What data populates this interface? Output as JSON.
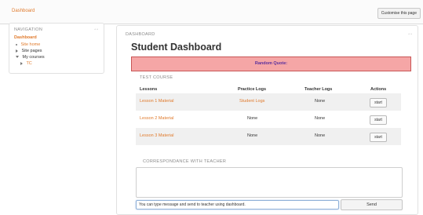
{
  "breadcrumb": {
    "home": "Dashboard"
  },
  "header": {
    "customise_label": "Customise this page"
  },
  "navigation": {
    "title": "NAVIGATION",
    "block_icons": "▫▫",
    "items": [
      {
        "label": "Dashboard",
        "level": 0
      },
      {
        "label": "Site home",
        "level": 1
      },
      {
        "label": "Site pages",
        "level": 1
      },
      {
        "label": "My courses",
        "level": 1
      },
      {
        "label": "TC",
        "level": 2
      }
    ]
  },
  "dashboard": {
    "block_title": "DASHBOARD",
    "block_icons": "▫▫",
    "title": "Student Dashboard",
    "quote_label": "Random Quote:",
    "course_heading": "TEST COURSE",
    "columns": [
      "Lessons",
      "Practice Logs",
      "Teacher Logs",
      "Actions"
    ],
    "rows": [
      {
        "lesson": "Lesson 1 Material",
        "practice": "Student Logs",
        "teacher": "None",
        "action": "start"
      },
      {
        "lesson": "Lesson 2 Material",
        "practice": "None",
        "teacher": "None",
        "action": "start"
      },
      {
        "lesson": "Lesson 3 Material",
        "practice": "None",
        "teacher": "None",
        "action": "start"
      }
    ],
    "correspondence_heading": "CORRESPONDANCE WITH TEACHER",
    "message_value": "You can type message and send to teacher using dashboard.",
    "send_label": "Send"
  },
  "colors": {
    "link": "#e07a2c",
    "quote_bg": "#f5a6a6",
    "quote_border": "#c85656",
    "quote_text": "#5a2f9c"
  }
}
